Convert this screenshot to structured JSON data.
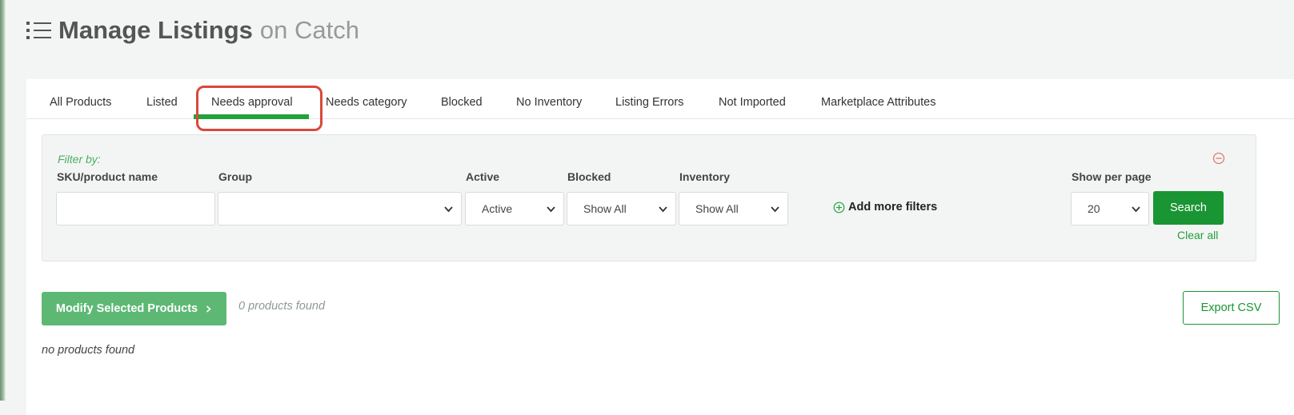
{
  "header": {
    "title_strong": "Manage Listings",
    "title_light": "on Catch"
  },
  "tabs": [
    {
      "label": "All Products",
      "active": false
    },
    {
      "label": "Listed",
      "active": false
    },
    {
      "label": "Needs approval",
      "active": true
    },
    {
      "label": "Needs category",
      "active": false
    },
    {
      "label": "Blocked",
      "active": false
    },
    {
      "label": "No Inventory",
      "active": false
    },
    {
      "label": "Listing Errors",
      "active": false
    },
    {
      "label": "Not Imported",
      "active": false
    },
    {
      "label": "Marketplace Attributes",
      "active": false
    }
  ],
  "filters": {
    "filter_by": "Filter by:",
    "sku_label": "SKU/product name",
    "sku_value": "",
    "group_label": "Group",
    "group_value": "",
    "active_label": "Active",
    "active_value": "Active",
    "blocked_label": "Blocked",
    "blocked_value": "Show All",
    "inventory_label": "Inventory",
    "inventory_value": "Show All",
    "add_more": "Add more filters",
    "per_page_label": "Show per page",
    "per_page_value": "20",
    "search_label": "Search",
    "clear_label": "Clear all"
  },
  "actions": {
    "modify_label": "Modify Selected Products",
    "found_text": "0 products found",
    "export_label": "Export CSV",
    "empty_text": "no products found"
  },
  "colors": {
    "accent": "#1a9533",
    "highlight": "#d9483b"
  }
}
